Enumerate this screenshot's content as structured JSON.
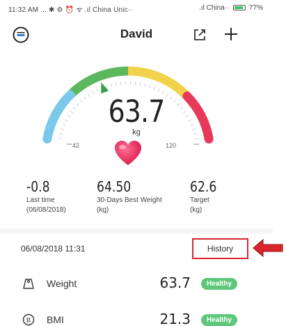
{
  "status_bar": {
    "left": "11:32 AM ... ✱ ⚙ ⏰ ᯤ .ıl China Unic··",
    "right": ".ıl China··",
    "battery": "77%"
  },
  "header": {
    "title": "David",
    "menu_icon": "profile-menu-icon",
    "share_icon": "share-icon",
    "add_icon": "plus-icon"
  },
  "gauge": {
    "value": "63.7",
    "unit": "kg",
    "tick_min": "42",
    "tick_max": "120",
    "level_fraction": 0.37,
    "segment_colors": [
      "#7bc8ea",
      "#5cb85c",
      "#f2d24b",
      "#e8395a"
    ]
  },
  "stats": [
    {
      "value": "-0.8",
      "label": "Last time",
      "sub": "(06/08/2018)"
    },
    {
      "value": "64.50",
      "label": "30-Days Best Weight",
      "sub": "(kg)"
    },
    {
      "value": "62.6",
      "label": "Target",
      "sub": "(kg)"
    }
  ],
  "history": {
    "date": "06/08/2018 11:31",
    "button_label": "History"
  },
  "metrics": [
    {
      "name": "Weight",
      "value": "63.7",
      "badge": "Healthy",
      "icon": "weight-icon"
    },
    {
      "name": "BMI",
      "value": "21.3",
      "badge": "Healthy",
      "icon": "bmi-icon"
    }
  ],
  "colors": {
    "healthy_badge": "#5fc77c",
    "highlight_red": "#d9262c",
    "heart": "#e0245e"
  }
}
